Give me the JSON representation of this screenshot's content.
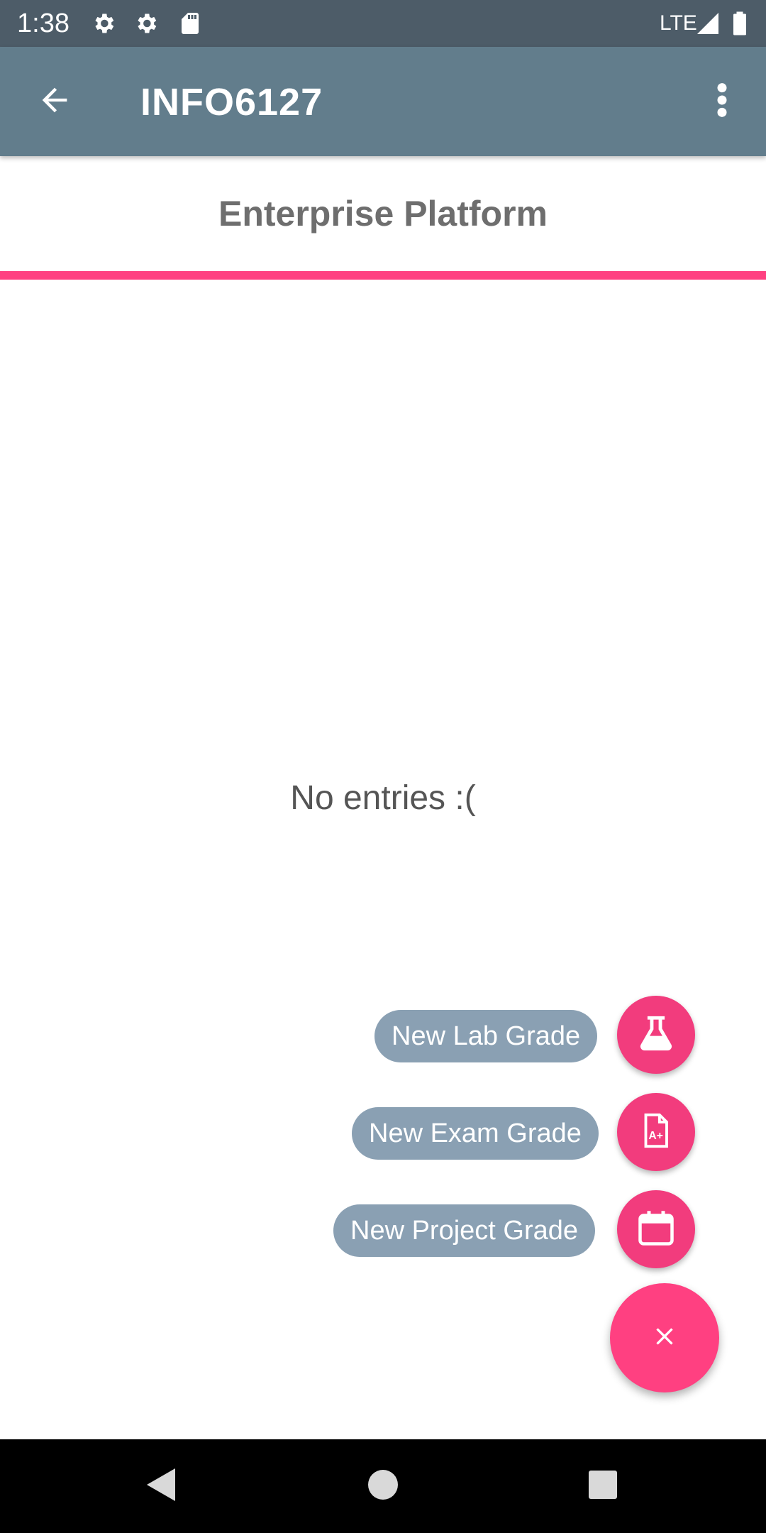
{
  "status_bar": {
    "time": "1:38",
    "network": "LTE",
    "icons": [
      "settings-icon",
      "settings-icon",
      "sd-card-icon",
      "signal-icon",
      "battery-icon"
    ]
  },
  "app_bar": {
    "title": "INFO6127",
    "back_icon": "arrow-back-icon",
    "menu_icon": "more-vert-icon"
  },
  "course": {
    "name": "Enterprise Platform"
  },
  "empty_state": {
    "message": "No entries :("
  },
  "fab_menu": {
    "items": [
      {
        "label": "New Lab Grade",
        "icon": "flask-icon"
      },
      {
        "label": "New Exam Grade",
        "icon": "grade-document-icon"
      },
      {
        "label": "New Project Grade",
        "icon": "calendar-icon"
      }
    ],
    "close_icon": "close-icon"
  },
  "colors": {
    "status_bar": "#4d5c68",
    "app_bar": "#627d8c",
    "accent": "#ff4081",
    "label_bg": "#8aa0b3"
  },
  "nav_bar": {
    "buttons": [
      "back-triangle-icon",
      "home-circle-icon",
      "recents-square-icon"
    ]
  }
}
